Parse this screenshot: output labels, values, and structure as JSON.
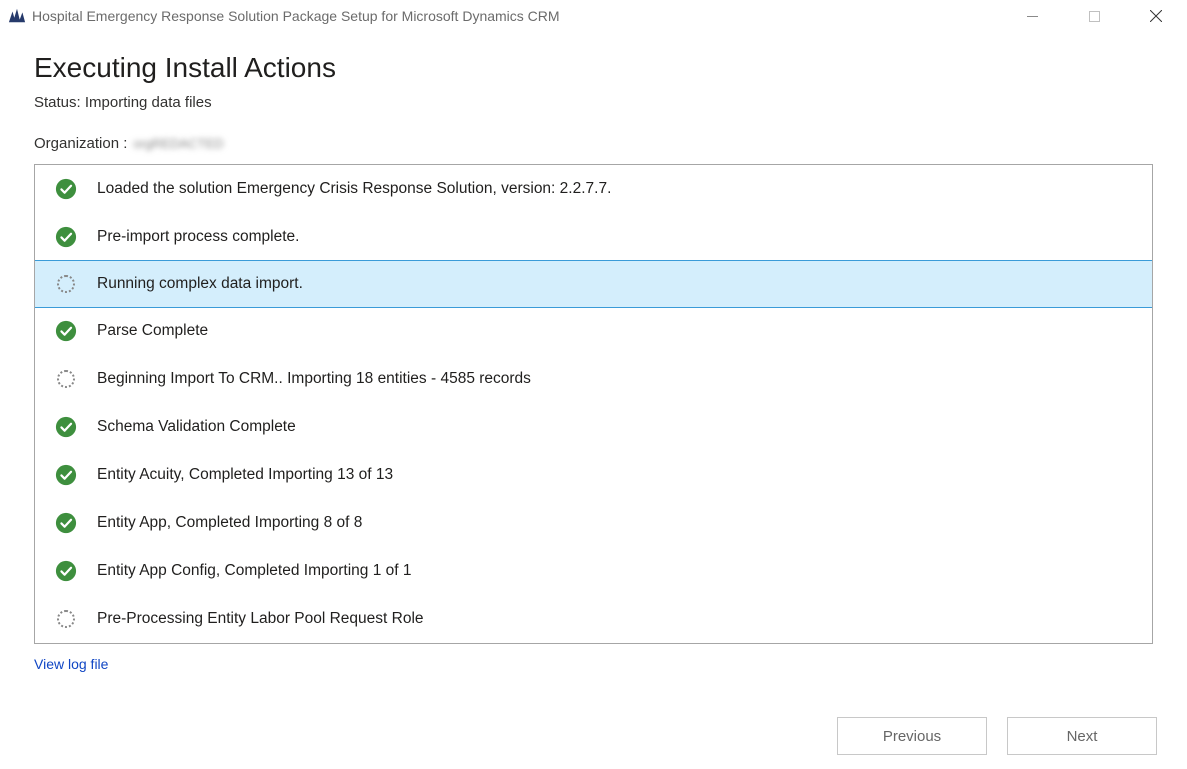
{
  "window": {
    "title": "Hospital Emergency Response Solution Package Setup for Microsoft Dynamics CRM"
  },
  "page": {
    "heading": "Executing Install Actions",
    "status_prefix": "Status: ",
    "status_value": "Importing data files",
    "org_label": "Organization :",
    "org_value": "orgREDACTED"
  },
  "rows": [
    {
      "status": "done",
      "selected": false,
      "text": "Loaded the solution Emergency Crisis Response Solution, version: 2.2.7.7."
    },
    {
      "status": "done",
      "selected": false,
      "text": "Pre-import process complete."
    },
    {
      "status": "running",
      "selected": true,
      "text": "Running complex data import."
    },
    {
      "status": "done",
      "selected": false,
      "text": "Parse Complete"
    },
    {
      "status": "running",
      "selected": false,
      "text": "Beginning Import To CRM.. Importing 18 entities - 4585 records"
    },
    {
      "status": "done",
      "selected": false,
      "text": "Schema Validation Complete"
    },
    {
      "status": "done",
      "selected": false,
      "text": "Entity Acuity, Completed Importing 13 of 13"
    },
    {
      "status": "done",
      "selected": false,
      "text": "Entity App, Completed Importing 8 of 8"
    },
    {
      "status": "done",
      "selected": false,
      "text": "Entity App Config, Completed Importing 1 of 1"
    },
    {
      "status": "running",
      "selected": false,
      "text": "Pre-Processing Entity Labor Pool Request Role"
    }
  ],
  "links": {
    "view_log": "View log file"
  },
  "buttons": {
    "previous": "Previous",
    "next": "Next"
  }
}
